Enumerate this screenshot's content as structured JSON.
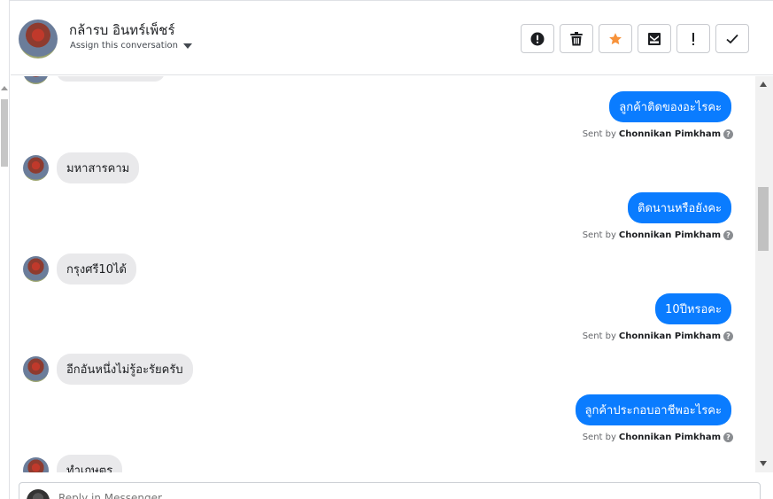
{
  "header": {
    "contact_name": "กล้ารบ อินทร์เพ็ชร์",
    "assign_label": "Assign this conversation",
    "actions": [
      "alert-circle-icon",
      "trash-icon",
      "star-icon",
      "mark-unread-icon",
      "important-icon",
      "done-check-icon"
    ],
    "star_color": "#f7923a"
  },
  "messages": [
    {
      "dir": "in",
      "text": ""
    },
    {
      "dir": "out",
      "text": "ลูกค้าติดของอะไรคะ",
      "sent_by_prefix": "Sent by",
      "sender": "Chonnikan Pimkham"
    },
    {
      "dir": "in",
      "text": "มหาสารคาม"
    },
    {
      "dir": "out",
      "text": "ติดนานหรือยังคะ",
      "sent_by_prefix": "Sent by",
      "sender": "Chonnikan Pimkham"
    },
    {
      "dir": "in",
      "text": "กรุงศรี10ได้"
    },
    {
      "dir": "out",
      "text": "10ปีหรอคะ",
      "sent_by_prefix": "Sent by",
      "sender": "Chonnikan Pimkham"
    },
    {
      "dir": "in",
      "text": "อีกอันหนึ่งไม่รู้อะรัยครับ"
    },
    {
      "dir": "out",
      "text": "ลูกค้าประกอบอาชีพอะไรคะ",
      "sent_by_prefix": "Sent by",
      "sender": "Chonnikan Pimkham"
    },
    {
      "dir": "in",
      "text": "ทำเกษตร"
    }
  ],
  "composer": {
    "placeholder": "Reply in Messenger..."
  },
  "colors": {
    "outgoing_bubble": "#0a7cff",
    "incoming_bubble": "#e9e9eb"
  }
}
